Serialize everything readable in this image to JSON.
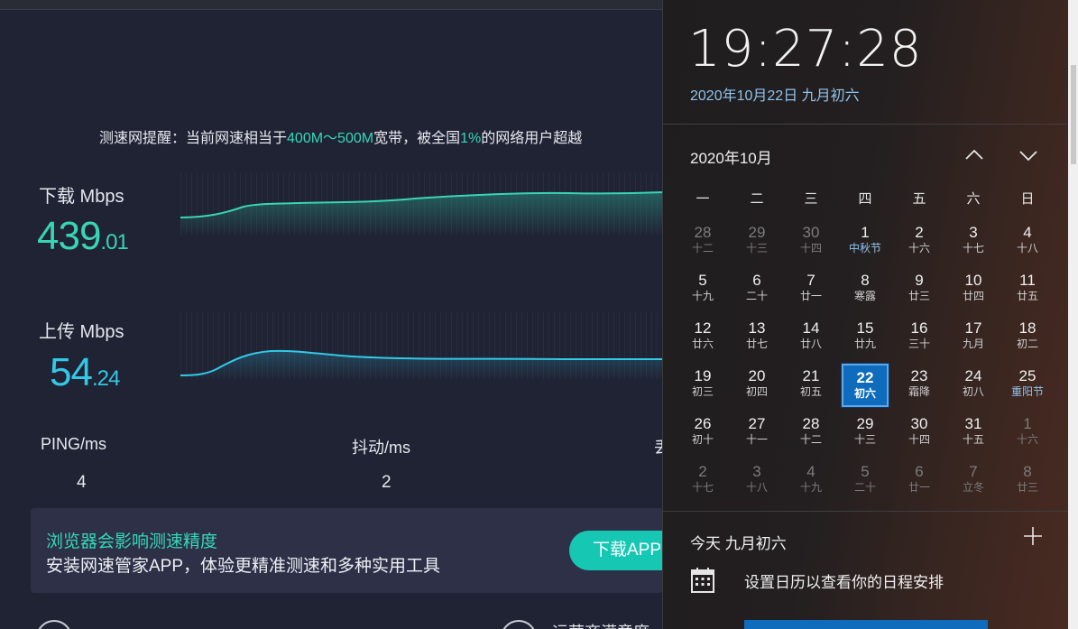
{
  "speedtest": {
    "tip": {
      "prefix": "测速网提醒：当前网速相当于",
      "range": "400M～500M",
      "mid": "宽带，被全国",
      "percent": "1%",
      "suffix": "的网络用户超越"
    },
    "download": {
      "label": "下载 Mbps",
      "int": "439",
      "dec": ".01"
    },
    "upload": {
      "label": "上传 Mbps",
      "int": "54",
      "dec": ".24"
    },
    "stats": [
      {
        "label": "PING/ms",
        "value": "4"
      },
      {
        "label": "抖动/ms",
        "value": "2"
      },
      {
        "label": "丢"
      }
    ],
    "banner": {
      "title": "浏览器会影响测速精度",
      "text": "安装网速管家APP，体验更精准测速和多种实用工具",
      "button": "下载APP"
    },
    "bottom_text": "运营商满意度",
    "colors": {
      "accent_green": "#39d4b4",
      "accent_cyan": "#32c8e6",
      "button": "#16c7b4"
    }
  },
  "flyout": {
    "time": "19:27:28",
    "date": "2020年10月22日 九月初六",
    "month": "2020年10月",
    "weekdays": [
      "一",
      "二",
      "三",
      "四",
      "五",
      "六",
      "日"
    ],
    "weeks": [
      [
        [
          "28",
          "十二",
          1,
          0
        ],
        [
          "29",
          "十三",
          1,
          0
        ],
        [
          "30",
          "十四",
          1,
          0
        ],
        [
          "1",
          "中秋节",
          0,
          1
        ],
        [
          "2",
          "十六",
          0,
          0
        ],
        [
          "3",
          "十七",
          0,
          0
        ],
        [
          "4",
          "十八",
          0,
          0
        ]
      ],
      [
        [
          "5",
          "十九",
          0,
          0
        ],
        [
          "6",
          "二十",
          0,
          0
        ],
        [
          "7",
          "廿一",
          0,
          0
        ],
        [
          "8",
          "寒露",
          0,
          0
        ],
        [
          "9",
          "廿三",
          0,
          0
        ],
        [
          "10",
          "廿四",
          0,
          0
        ],
        [
          "11",
          "廿五",
          0,
          0
        ]
      ],
      [
        [
          "12",
          "廿六",
          0,
          0
        ],
        [
          "13",
          "廿七",
          0,
          0
        ],
        [
          "14",
          "廿八",
          0,
          0
        ],
        [
          "15",
          "廿九",
          0,
          0
        ],
        [
          "16",
          "三十",
          0,
          0
        ],
        [
          "17",
          "九月",
          0,
          0
        ],
        [
          "18",
          "初二",
          0,
          0
        ]
      ],
      [
        [
          "19",
          "初三",
          0,
          0
        ],
        [
          "20",
          "初四",
          0,
          0
        ],
        [
          "21",
          "初五",
          0,
          0
        ],
        [
          "22",
          "初六",
          0,
          2
        ],
        [
          "23",
          "霜降",
          0,
          0
        ],
        [
          "24",
          "初八",
          0,
          0
        ],
        [
          "25",
          "重阳节",
          0,
          1
        ]
      ],
      [
        [
          "26",
          "初十",
          0,
          0
        ],
        [
          "27",
          "十一",
          0,
          0
        ],
        [
          "28",
          "十二",
          0,
          0
        ],
        [
          "29",
          "十三",
          0,
          0
        ],
        [
          "30",
          "十四",
          0,
          0
        ],
        [
          "31",
          "十五",
          0,
          0
        ],
        [
          "1",
          "十六",
          1,
          0
        ]
      ],
      [
        [
          "2",
          "十七",
          1,
          0
        ],
        [
          "3",
          "十八",
          1,
          0
        ],
        [
          "4",
          "十九",
          1,
          0
        ],
        [
          "5",
          "二十",
          1,
          0
        ],
        [
          "6",
          "廿一",
          1,
          0
        ],
        [
          "7",
          "立冬",
          1,
          0
        ],
        [
          "8",
          "廿三",
          1,
          0
        ]
      ]
    ],
    "agenda_title": "今天 九月初六",
    "agenda_hint": "设置日历以查看你的日程安排",
    "icons": [
      "chevron-up-icon",
      "chevron-down-icon",
      "plus-icon",
      "calendar-icon"
    ],
    "colors": {
      "today_bg": "#0f6cbd",
      "festival_text": "#8fc3ec"
    }
  }
}
